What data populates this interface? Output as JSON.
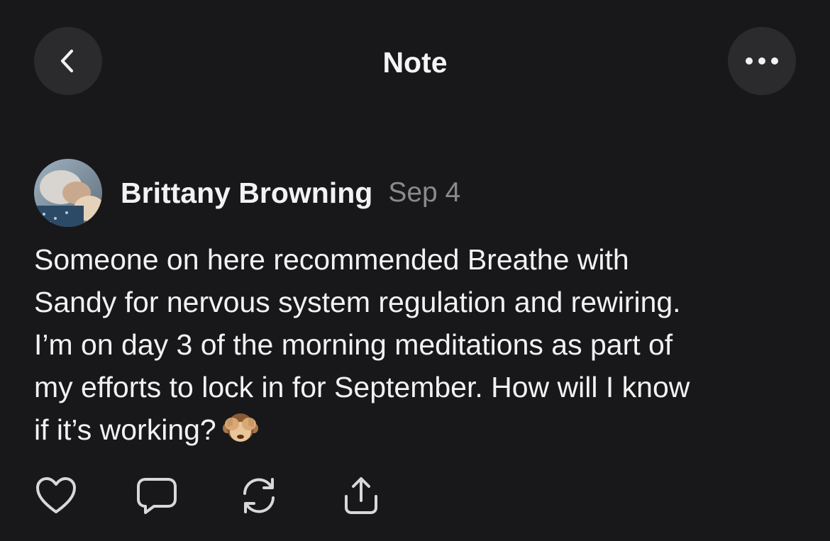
{
  "header": {
    "title": "Note",
    "back_icon": "chevron-left-icon",
    "more_icon": "ellipsis-icon"
  },
  "post": {
    "author": "Brittany Browning",
    "date": "Sep 4",
    "body_lines": [
      "Someone on here recommended Breathe with",
      "Sandy for nervous system regulation and rewiring.",
      "I’m on day 3 of the morning meditations as part of",
      "my efforts to lock in for September. How will I know",
      "if it’s working?"
    ],
    "emoji": "see-no-evil-monkey-icon"
  },
  "actions": [
    {
      "name": "like",
      "icon": "heart-icon"
    },
    {
      "name": "comment",
      "icon": "speech-bubble-icon"
    },
    {
      "name": "restack",
      "icon": "restack-icon"
    },
    {
      "name": "share",
      "icon": "share-icon"
    }
  ],
  "colors": {
    "background": "#18181a",
    "button_bg": "#2b2b2d",
    "text": "#f2f2f2",
    "muted": "#8a8a8e"
  }
}
